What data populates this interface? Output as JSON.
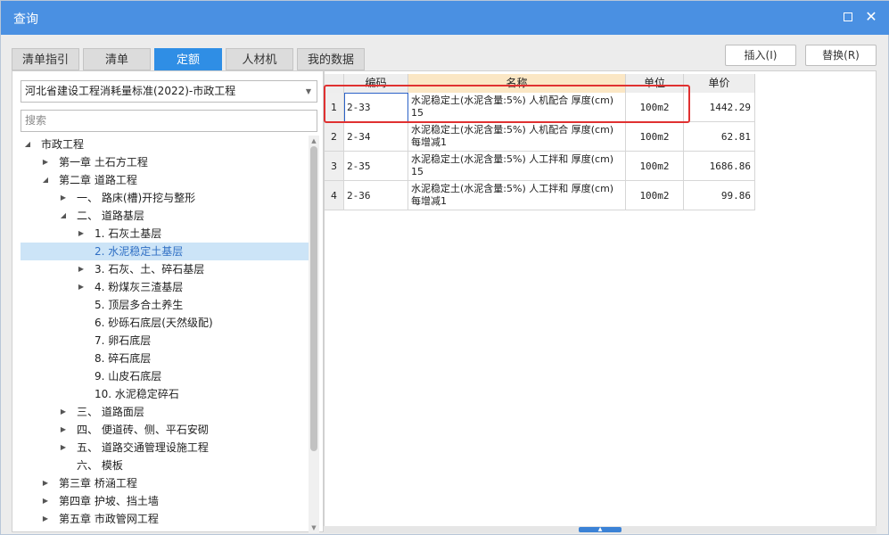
{
  "window": {
    "title": "查询"
  },
  "tabs": [
    {
      "label": "清单指引",
      "active": false
    },
    {
      "label": "清单",
      "active": false
    },
    {
      "label": "定额",
      "active": true
    },
    {
      "label": "人材机",
      "active": false
    },
    {
      "label": "我的数据",
      "active": false
    }
  ],
  "toolbar": {
    "insert_label": "插入(I)",
    "replace_label": "替换(R)"
  },
  "left": {
    "standard_value": "河北省建设工程消耗量标准(2022)-市政工程",
    "search_placeholder": "搜索",
    "tree": [
      {
        "label": "市政工程",
        "toggle": "expanded"
      },
      {
        "label": "第一章 土石方工程",
        "toggle": "collapsed"
      },
      {
        "label": "第二章 道路工程",
        "toggle": "expanded"
      },
      {
        "label": "一、 路床(槽)开挖与整形",
        "toggle": "collapsed"
      },
      {
        "label": "二、 道路基层",
        "toggle": "expanded"
      },
      {
        "label": "1. 石灰土基层",
        "toggle": "collapsed"
      },
      {
        "label": "2. 水泥稳定土基层",
        "toggle": "none",
        "selected": true
      },
      {
        "label": "3. 石灰、土、碎石基层",
        "toggle": "collapsed"
      },
      {
        "label": "4. 粉煤灰三渣基层",
        "toggle": "collapsed"
      },
      {
        "label": "5. 顶层多合土养生",
        "toggle": "none"
      },
      {
        "label": "6. 砂砾石底层(天然级配)",
        "toggle": "none"
      },
      {
        "label": "7. 卵石底层",
        "toggle": "none"
      },
      {
        "label": "8. 碎石底层",
        "toggle": "none"
      },
      {
        "label": "9. 山皮石底层",
        "toggle": "none"
      },
      {
        "label": "10. 水泥稳定碎石",
        "toggle": "none"
      },
      {
        "label": "三、 道路面层",
        "toggle": "collapsed"
      },
      {
        "label": "四、 便道砖、侧、平石安砌",
        "toggle": "collapsed"
      },
      {
        "label": "五、 道路交通管理设施工程",
        "toggle": "collapsed"
      },
      {
        "label": "六、 模板",
        "toggle": "none"
      },
      {
        "label": "第三章 桥涵工程",
        "toggle": "collapsed"
      },
      {
        "label": "第四章 护坡、挡土墙",
        "toggle": "collapsed"
      },
      {
        "label": "第五章 市政管网工程",
        "toggle": "collapsed"
      }
    ]
  },
  "grid": {
    "columns": {
      "code": "编码",
      "name": "名称",
      "unit": "单位",
      "price": "单价"
    },
    "rows": [
      {
        "idx": "1",
        "code": "2-33",
        "name": "水泥稳定土(水泥含量:5%) 人机配合 厚度(cm) 15",
        "unit": "100m2",
        "price": "1442.29"
      },
      {
        "idx": "2",
        "code": "2-34",
        "name": "水泥稳定土(水泥含量:5%) 人机配合 厚度(cm) 每增减1",
        "unit": "100m2",
        "price": "62.81"
      },
      {
        "idx": "3",
        "code": "2-35",
        "name": "水泥稳定土(水泥含量:5%) 人工拌和 厚度(cm) 15",
        "unit": "100m2",
        "price": "1686.86"
      },
      {
        "idx": "4",
        "code": "2-36",
        "name": "水泥稳定土(水泥含量:5%) 人工拌和 厚度(cm) 每增减1",
        "unit": "100m2",
        "price": "99.86"
      }
    ]
  },
  "colors": {
    "titlebar": "#4a90e2",
    "active_tab": "#2f8ee5",
    "tree_selected": "#cce4f7",
    "highlight": "#e03131"
  }
}
